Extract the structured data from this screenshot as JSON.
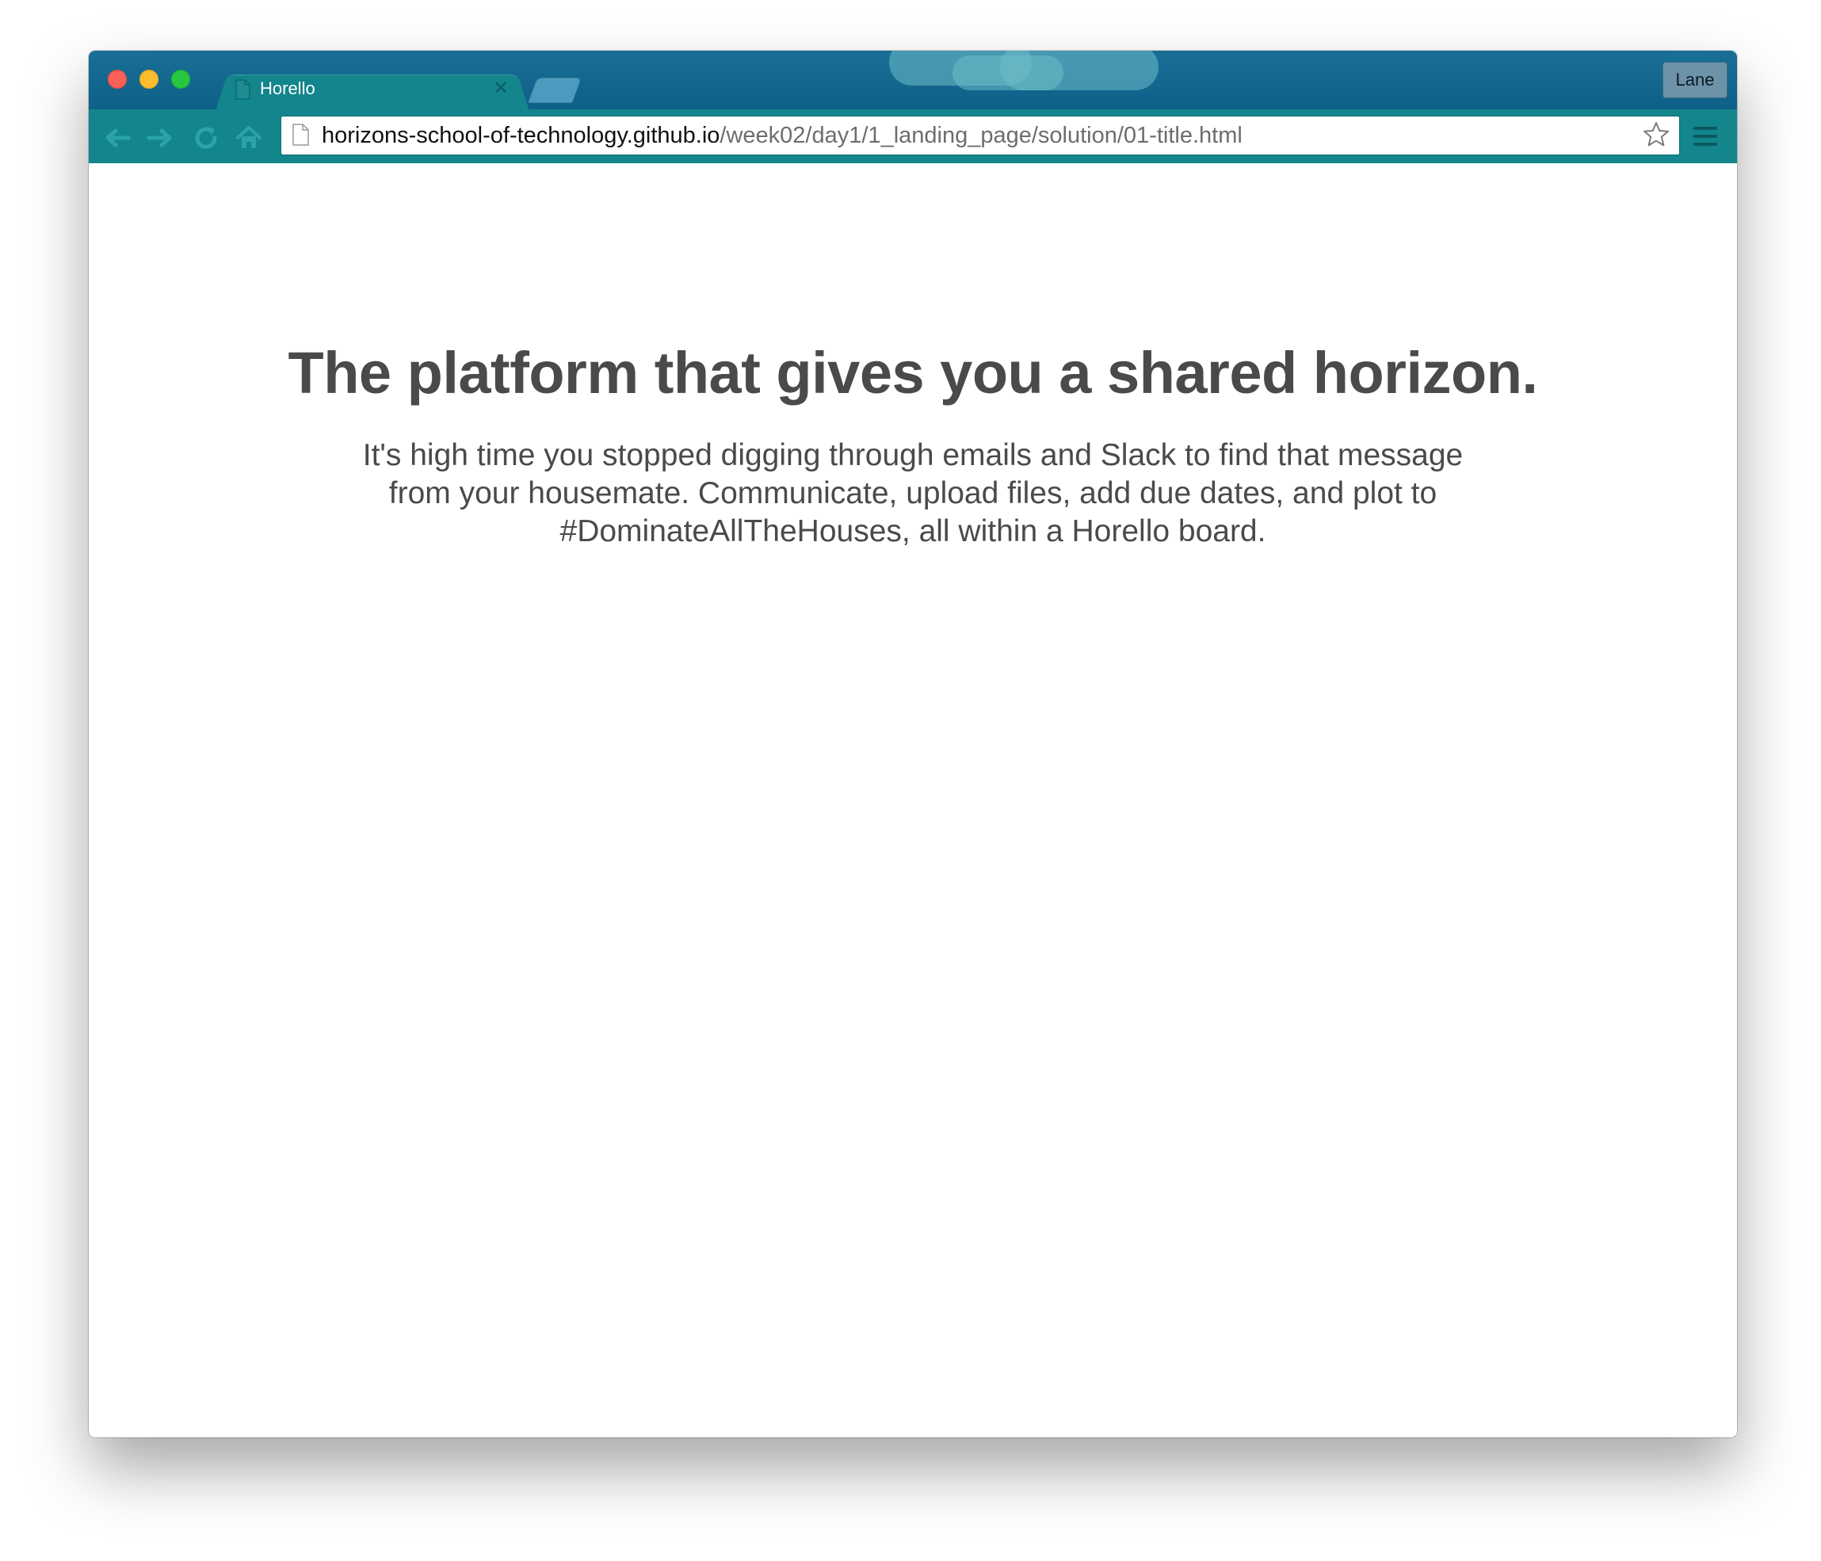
{
  "browser": {
    "tab": {
      "title": "Horello"
    },
    "profile_label": "Lane",
    "address": {
      "host": "horizons-school-of-technology.github.io",
      "path": "/week02/day1/1_landing_page/solution/01-title.html"
    },
    "icons": {
      "back": "arrow-left-icon",
      "forward": "arrow-right-icon",
      "reload": "reload-icon",
      "home": "home-icon",
      "page": "document-icon",
      "bookmark": "star-icon",
      "menu": "hamburger-menu-icon",
      "tab_close": "close-icon"
    },
    "colors": {
      "titlebar": "#0e6088",
      "toolbar": "#13858c",
      "text": "#4a4a4a"
    }
  },
  "page": {
    "headline": "The platform that gives you a shared horizon.",
    "subtext": "It's high time you stopped digging through emails and Slack to find that message from your housemate. Communicate, upload files, add due dates, and plot to #DominateAllTheHouses, all within a Horello board."
  }
}
